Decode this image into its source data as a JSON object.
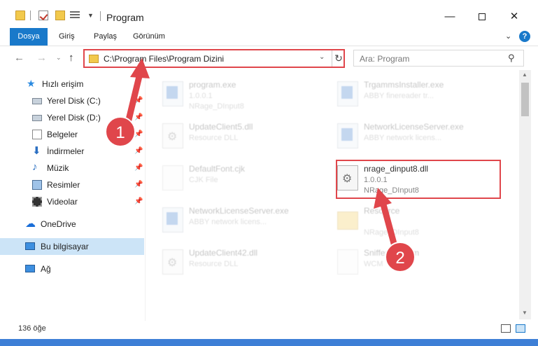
{
  "title_bar": {
    "title": "Program",
    "window_controls": {
      "minimize": "—",
      "close": "✕"
    }
  },
  "ribbon": {
    "tabs": [
      "Dosya",
      "Giriş",
      "Paylaş",
      "Görünüm"
    ],
    "help": "?"
  },
  "navigation": {
    "address": "C:\\Program Files\\Program Dizini",
    "search_placeholder": "Ara: Program"
  },
  "sidebar": {
    "items": [
      {
        "label": "Hızlı erişim",
        "icon": "star-icon"
      },
      {
        "label": "Yerel Disk (C:)",
        "icon": "drive-icon"
      },
      {
        "label": "Yerel Disk (D:)",
        "icon": "drive-icon"
      },
      {
        "label": "Belgeler",
        "icon": "documents-icon"
      },
      {
        "label": "İndirmeler",
        "icon": "download-icon"
      },
      {
        "label": "Müzik",
        "icon": "music-icon"
      },
      {
        "label": "Resimler",
        "icon": "pictures-icon"
      },
      {
        "label": "Videolar",
        "icon": "videos-icon"
      },
      {
        "label": "OneDrive",
        "icon": "cloud-icon"
      },
      {
        "label": "Bu bilgisayar",
        "icon": "computer-icon"
      },
      {
        "label": "Ağ",
        "icon": "network-icon"
      }
    ]
  },
  "files": [
    {
      "name": "program.exe",
      "line1": "1.0.0.1",
      "line2": "NRage_DInput8",
      "icon": "exe-icon"
    },
    {
      "name": "TrgammsInstaller.exe",
      "line1": "ABBY finereader tr...",
      "line2": "",
      "icon": "exe-icon"
    },
    {
      "name": "UpdateClient5.dll",
      "line1": "Resource DLL",
      "line2": "",
      "icon": "dll-icon"
    },
    {
      "name": "NetworkLicenseServer.exe",
      "line1": "ABBY network licens...",
      "line2": "",
      "icon": "exe-icon"
    },
    {
      "name": "DefaultFont.cjk",
      "line1": "CJK File",
      "line2": "",
      "icon": "file-icon"
    },
    {
      "name": "nrage_dinput8.dll",
      "line1": "1.0.0.1",
      "line2": "NRage_DInput8",
      "icon": "dll-icon"
    },
    {
      "name": "NetworkLicenseServer.exe",
      "line1": "ABBY network licens...",
      "line2": "",
      "icon": "exe-icon"
    },
    {
      "name": "Resource",
      "line1": "",
      "line2": "NRage_DInput8",
      "icon": "folder-icon"
    },
    {
      "name": "UpdateClient42.dll",
      "line1": "Resource DLL",
      "line2": "",
      "icon": "dll-icon"
    },
    {
      "name": "SnifferDS.wcm",
      "line1": "WCM",
      "line2": "",
      "icon": "file-icon"
    }
  ],
  "status": {
    "count": "136 öğe"
  },
  "annotations": {
    "badge1": "1",
    "badge2": "2",
    "color": "#e0464b"
  }
}
